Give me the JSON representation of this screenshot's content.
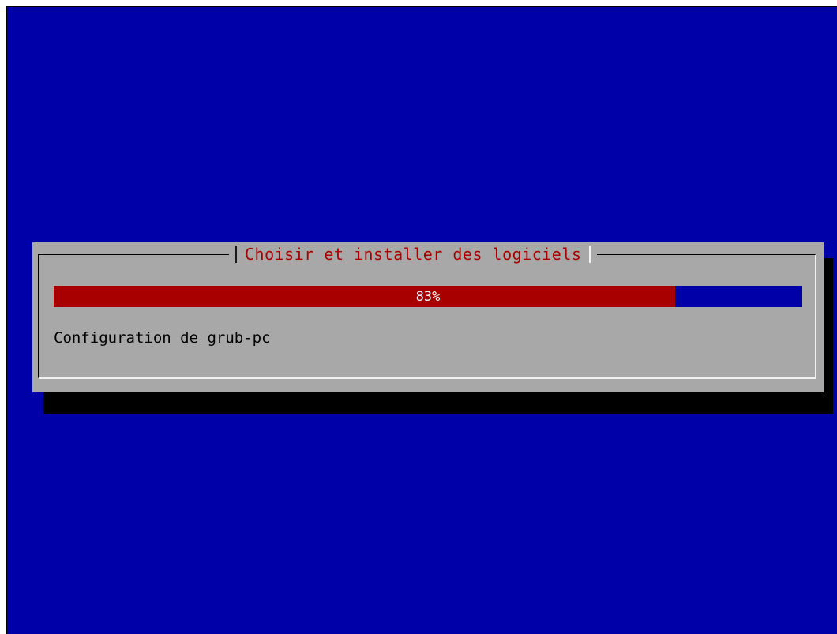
{
  "dialog": {
    "title": "Choisir et installer des logiciels",
    "progress": {
      "percent": 83,
      "label": "83%"
    },
    "status": "Configuration de grub-pc"
  },
  "colors": {
    "screen_background": "#0000a8",
    "dialog_background": "#a8a8a8",
    "title_text": "#a80000",
    "progress_fill": "#a80000",
    "progress_track": "#0000a8",
    "progress_text": "#f2f2f2"
  }
}
